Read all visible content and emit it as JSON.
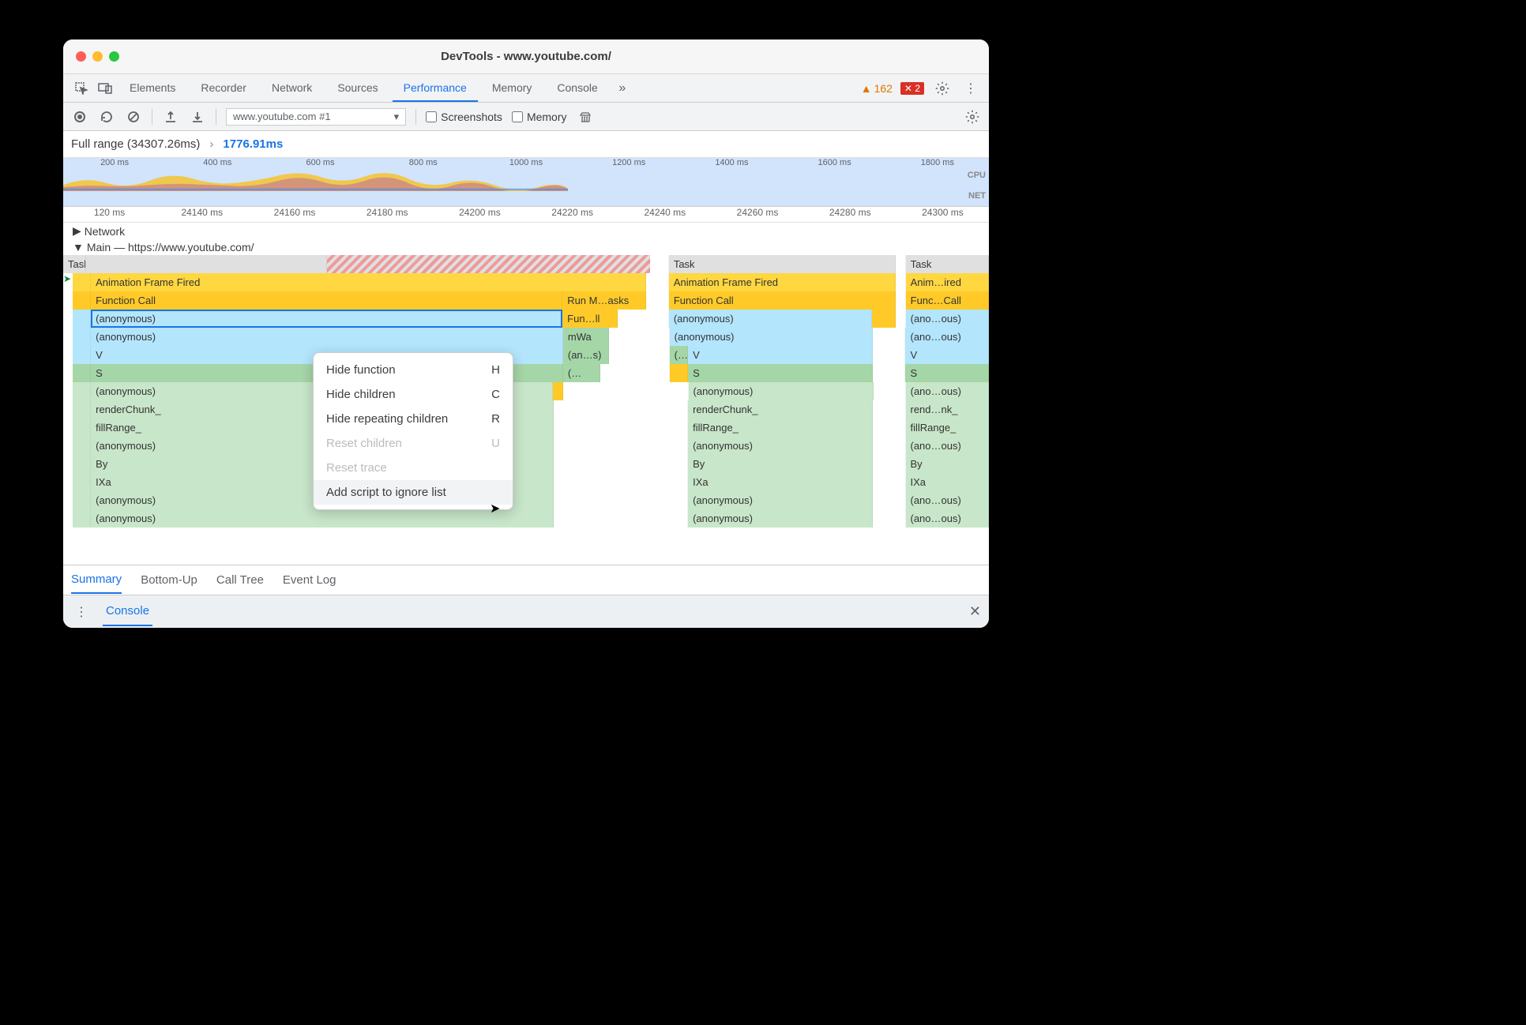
{
  "window": {
    "title": "DevTools - www.youtube.com/"
  },
  "tabs": {
    "items": [
      "Elements",
      "Recorder",
      "Network",
      "Sources",
      "Performance",
      "Memory",
      "Console"
    ],
    "active_index": 4,
    "warnings_count": "162",
    "errors_count": "2"
  },
  "toolbar": {
    "recording_name": "www.youtube.com #1",
    "cb_screenshots": "Screenshots",
    "cb_memory": "Memory"
  },
  "breadcrumb": {
    "full_range": "Full range (34307.26ms)",
    "current": "1776.91ms"
  },
  "overview": {
    "ticks": [
      "200 ms",
      "400 ms",
      "600 ms",
      "800 ms",
      "1000 ms",
      "1200 ms",
      "1400 ms",
      "1600 ms",
      "1800 ms"
    ],
    "label_cpu": "CPU",
    "label_net": "NET"
  },
  "ruler": {
    "ticks": [
      "120 ms",
      "24140 ms",
      "24160 ms",
      "24180 ms",
      "24200 ms",
      "24220 ms",
      "24240 ms",
      "24260 ms",
      "24280 ms",
      "24300 ms"
    ]
  },
  "tracks": {
    "network": "Network",
    "main": "Main — https://www.youtube.com/",
    "task": "Task",
    "aff": "Animation Frame Fired",
    "fcall": "Function Call",
    "anon": "(anonymous)",
    "v": "V",
    "s": "S",
    "renderchunk": "renderChunk_",
    "fillrange": "fillRange_",
    "by": "By",
    "ixa": "IXa",
    "run_m": "Run M…asks",
    "fun_ll": "Fun…ll",
    "mwa": "mWa",
    "an_s": "(an…s)",
    "paren": "(…",
    "anim_short": "Anim…ired",
    "func_short": "Func…Call",
    "ano_short": "(ano…ous)",
    "rend_short": "rend…nk_"
  },
  "context_menu": {
    "items": [
      {
        "label": "Hide function",
        "shortcut": "H",
        "disabled": false
      },
      {
        "label": "Hide children",
        "shortcut": "C",
        "disabled": false
      },
      {
        "label": "Hide repeating children",
        "shortcut": "R",
        "disabled": false
      },
      {
        "label": "Reset children",
        "shortcut": "U",
        "disabled": true
      },
      {
        "label": "Reset trace",
        "shortcut": "",
        "disabled": true
      },
      {
        "label": "Add script to ignore list",
        "shortcut": "",
        "disabled": false,
        "highlighted": true
      }
    ]
  },
  "bottom_tabs": {
    "items": [
      "Summary",
      "Bottom-Up",
      "Call Tree",
      "Event Log"
    ],
    "active_index": 0
  },
  "drawer": {
    "tab": "Console"
  }
}
